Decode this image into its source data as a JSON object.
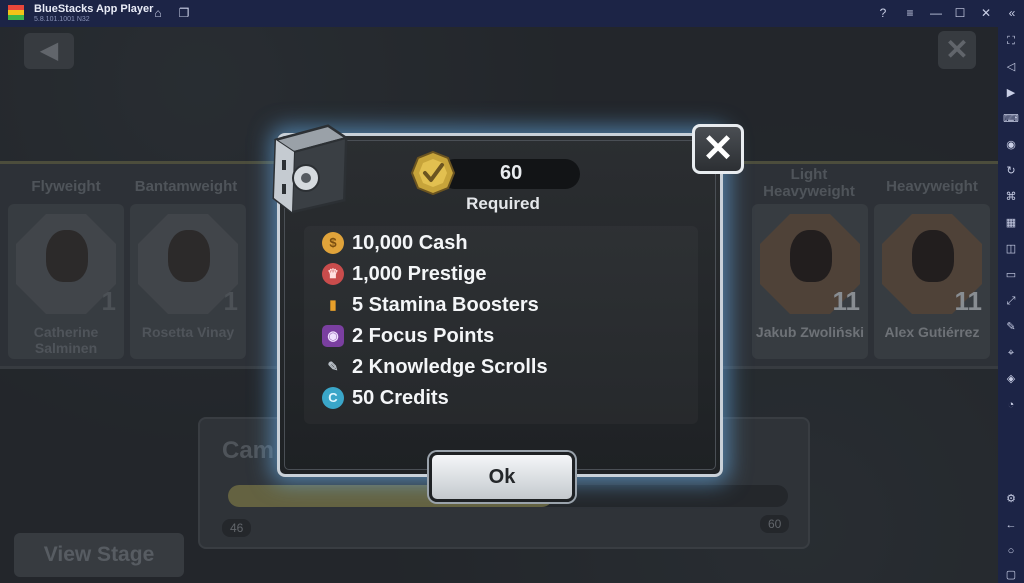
{
  "window": {
    "title": "BlueStacks App Player",
    "version": "5.8.101.1001 N32",
    "controls": [
      "help-icon",
      "menu-icon",
      "minimize-icon",
      "maximize-icon",
      "close-icon"
    ]
  },
  "sidebar": {
    "icons": [
      "fullscreen-icon",
      "volume-icon",
      "video-icon",
      "keyboard-icon",
      "gamepad-icon",
      "rotate-icon",
      "shake-icon",
      "macro-icon",
      "screenshot-icon",
      "folder-icon",
      "resize-icon",
      "location-icon",
      "layers-icon",
      "speed-icon",
      "settings-icon",
      "back-icon",
      "home-icon"
    ]
  },
  "game": {
    "weight_classes": [
      "Flyweight",
      "Bantamweight",
      "Light Heavyweight",
      "Heavyweight"
    ],
    "fighters": [
      {
        "name": "Catherine Salminen",
        "level": "1"
      },
      {
        "name": "Rosetta Vinay",
        "level": "1"
      },
      {
        "name": "Jakub Zwoliński",
        "level": "11"
      },
      {
        "name": "Alex Gutiérrez",
        "level": "11"
      }
    ],
    "campaign": {
      "title": "Cam",
      "progress_start": "46",
      "progress_end": "60",
      "progress_fraction": 0.58
    },
    "view_stage_label": "View Stage"
  },
  "modal": {
    "required_amount": "60",
    "required_label": "Required",
    "rewards": [
      {
        "icon": "cash-icon",
        "text": "10,000 Cash",
        "color": "#e0a33a"
      },
      {
        "icon": "prestige-icon",
        "text": "1,000 Prestige",
        "color": "#c94c4c"
      },
      {
        "icon": "stamina-icon",
        "text": "5 Stamina Boosters",
        "color": "#e8a02a"
      },
      {
        "icon": "focus-icon",
        "text": "2 Focus Points",
        "color": "#7a3fa0"
      },
      {
        "icon": "scroll-icon",
        "text": "2 Knowledge Scrolls",
        "color": "#9aa3ac"
      },
      {
        "icon": "credits-icon",
        "text": "50 Credits",
        "color": "#3aa6c9"
      }
    ],
    "ok_label": "Ok"
  }
}
